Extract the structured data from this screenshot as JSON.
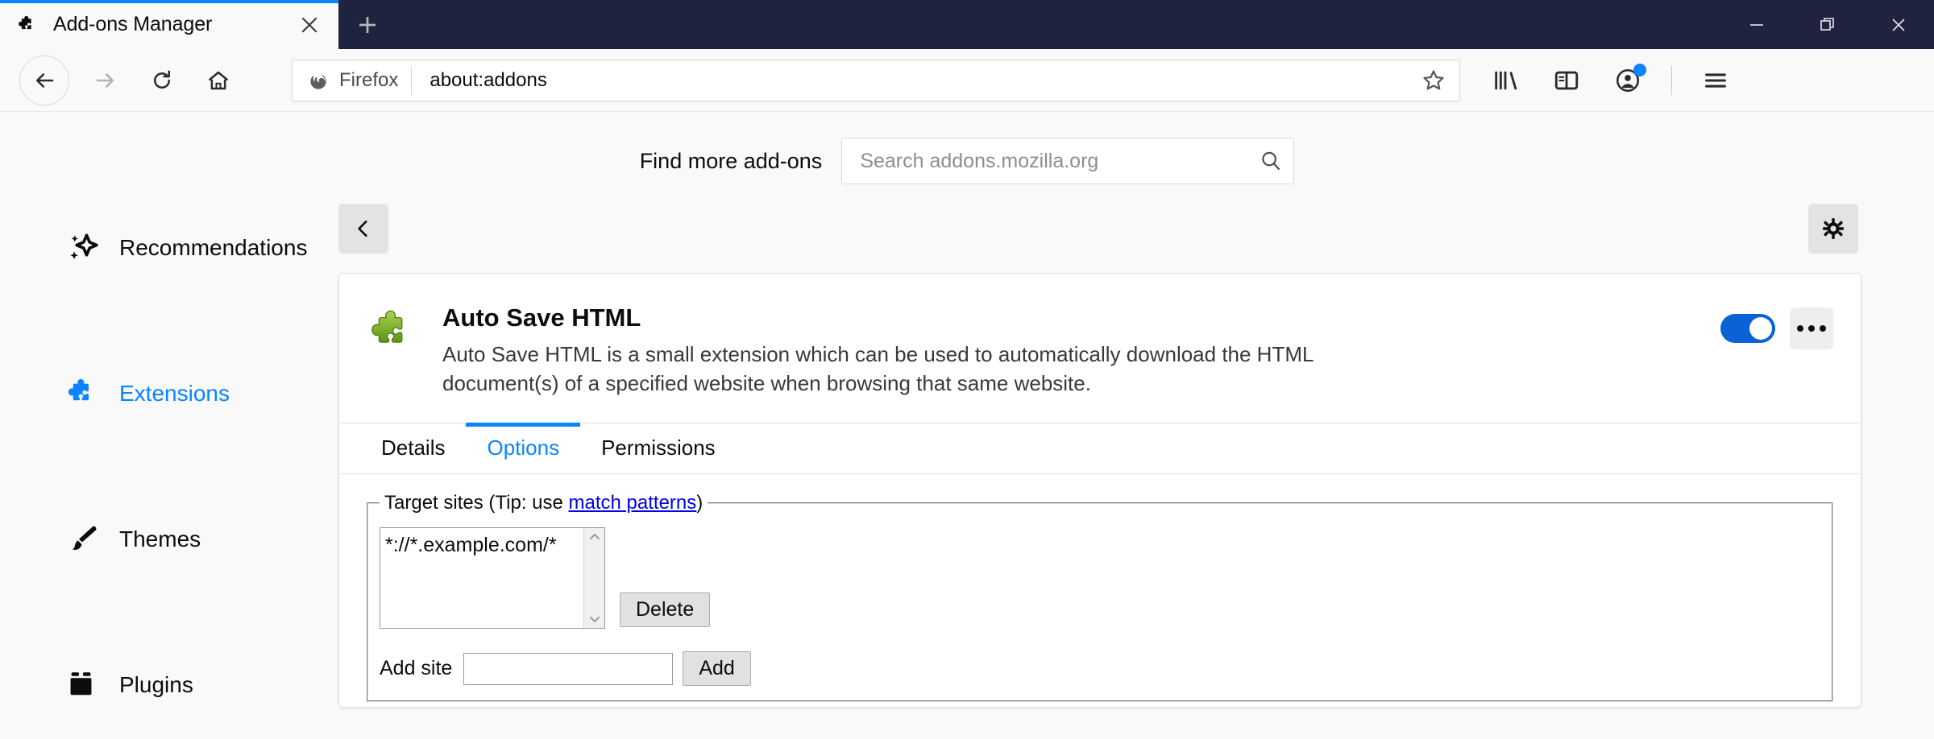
{
  "window": {
    "controls": {
      "minimize": "minimize-button",
      "restore": "restore-button",
      "close": "close-button"
    }
  },
  "tabstrip": {
    "tab_title": "Add-ons Manager",
    "tab_favicon": "puzzle-piece-icon",
    "close_tab": "×",
    "new_tab": "+"
  },
  "toolbar": {
    "back": "back-arrow",
    "forward": "forward-arrow",
    "reload": "reload-arrow",
    "home": "home-icon",
    "identity_label": "Firefox",
    "url": "about:addons",
    "bookmark_star": "star-outline-icon",
    "library": "library-icon",
    "sidebar": "sidebar-icon",
    "account": "account-icon",
    "menu": "hamburger-menu-icon"
  },
  "page": {
    "find_more_label": "Find more add-ons",
    "search": {
      "placeholder": "Search addons.mozilla.org",
      "value": ""
    },
    "back_button": "‹",
    "settings_button": "gear-icon"
  },
  "sidebar": {
    "items": [
      {
        "label": "Recommendations",
        "icon": "sparkle-star-icon",
        "active": false
      },
      {
        "label": "Extensions",
        "icon": "puzzle-piece-icon",
        "active": true
      },
      {
        "label": "Themes",
        "icon": "paintbrush-icon",
        "active": false
      },
      {
        "label": "Plugins",
        "icon": "plugin-box-icon",
        "active": false
      }
    ]
  },
  "addon": {
    "icon": "green-puzzle-piece-icon",
    "name": "Auto Save HTML",
    "description": "Auto Save HTML is a small extension which can be used to automatically download the HTML document(s) of a specified website when browsing that same website.",
    "enabled": true,
    "more_button": "•••",
    "tabs": [
      {
        "label": "Details",
        "active": false
      },
      {
        "label": "Options",
        "active": true
      },
      {
        "label": "Permissions",
        "active": false
      }
    ]
  },
  "options": {
    "legend_prefix": "Target sites (Tip: use ",
    "legend_link": "match patterns",
    "legend_suffix": ")",
    "sites": [
      "*://*.example.com/*"
    ],
    "scroll_up": "⌃",
    "scroll_down": "⌄",
    "delete_label": "Delete",
    "add_site_label": "Add site",
    "add_site_value": "",
    "add_label": "Add"
  },
  "colors": {
    "accent_blue": "#0a84ff",
    "tabstrip_bg": "#20233f",
    "page_bg": "#f9f9fa",
    "toggle_on": "#0a63d6",
    "link": "#0000ee",
    "addon_icon_green": "#7bb026"
  }
}
